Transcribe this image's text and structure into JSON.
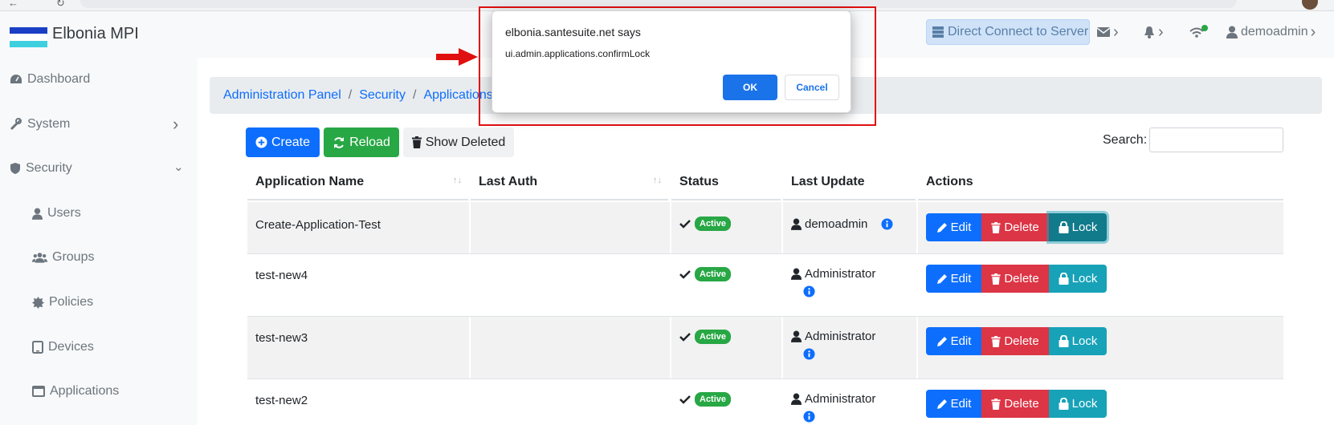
{
  "app": {
    "brand": "Elbonia MPI",
    "flag_colors": [
      "#1a3fc4",
      "#ffffff",
      "#3fd0e0"
    ]
  },
  "header": {
    "direct_connect": "Direct Connect to Server",
    "user": "demoadmin",
    "icons": [
      "server-icon",
      "envelope-icon",
      "bell-icon",
      "wifi-icon",
      "user-icon"
    ]
  },
  "sidebar": {
    "items": [
      {
        "label": "Dashboard",
        "icon": "tachometer-icon"
      },
      {
        "label": "System",
        "icon": "tools-icon"
      },
      {
        "label": "Security",
        "icon": "shield-icon"
      },
      {
        "label": "Users",
        "icon": "user-icon"
      },
      {
        "label": "Groups",
        "icon": "users-icon"
      },
      {
        "label": "Policies",
        "icon": "certificate-icon"
      },
      {
        "label": "Devices",
        "icon": "tablet-icon"
      },
      {
        "label": "Applications",
        "icon": "window-icon"
      }
    ]
  },
  "breadcrumb": {
    "items": [
      "Administration Panel",
      "Security",
      "Applications"
    ]
  },
  "toolbar": {
    "create": "Create",
    "reload": "Reload",
    "show_deleted": "Show Deleted",
    "search_label": "Search:",
    "search_value": ""
  },
  "table": {
    "columns": [
      "Application Name",
      "Last Auth",
      "Status",
      "Last Update",
      "Actions"
    ],
    "actions": {
      "edit": "Edit",
      "delete": "Delete",
      "lock": "Lock"
    },
    "rows": [
      {
        "name": "Create-Application-Test",
        "last_auth": "",
        "status": "Active",
        "updated_by": "demoadmin"
      },
      {
        "name": "test-new4",
        "last_auth": "",
        "status": "Active",
        "updated_by": "Administrator"
      },
      {
        "name": "test-new3",
        "last_auth": "",
        "status": "Active",
        "updated_by": "Administrator"
      },
      {
        "name": "test-new2",
        "last_auth": "",
        "status": "Active",
        "updated_by": "Administrator"
      }
    ]
  },
  "dialog": {
    "title": "elbonia.santesuite.net says",
    "message": "ui.admin.applications.confirmLock",
    "ok": "OK",
    "cancel": "Cancel"
  },
  "colors": {
    "primary": "#0d6efd",
    "success": "#28a745",
    "danger": "#dc3545",
    "info": "#17a2b8",
    "annotation_red": "#e01010"
  }
}
